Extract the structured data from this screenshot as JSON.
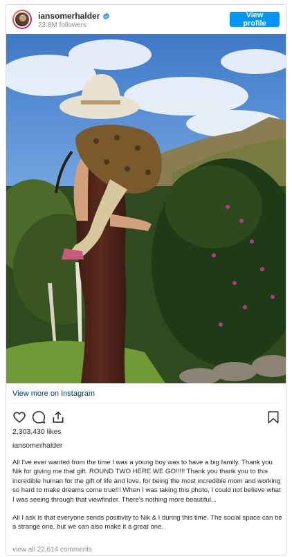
{
  "header": {
    "username": "iansomerhalder",
    "followers": "23.8M followers",
    "view_profile_label": "View profile"
  },
  "post": {
    "view_more_label": "View more on Instagram",
    "likes": "2,303,430 likes",
    "author": "iansomerhalder",
    "caption_p1": "All I've ever wanted from the time I was a young boy was to have a big family. Thank you Nik for giving me that gift. ROUND TWO HERE WE GO!!!!! Thank you thank you to this incredible human for the gift of life and love, for being the most incredible mom and working so hard to make dreams come true!!! When I was taking this photo, I could not believe what I was seeing through that viewfinder. There's nothing more beautiful...",
    "caption_p2": "All I ask is that everyone sends positivity to Nik & I during this time. The social space can be a strange one, but we can also make it a great one.",
    "view_comments_label": "view all 22,614 comments"
  },
  "icons": {
    "verified": "verified-badge-icon",
    "like": "heart-icon",
    "comment": "comment-bubble-icon",
    "share": "share-icon",
    "save": "bookmark-icon"
  },
  "colors": {
    "accent": "#0095f6",
    "link": "#00376b",
    "muted": "#8e8e8e",
    "text": "#262626"
  }
}
